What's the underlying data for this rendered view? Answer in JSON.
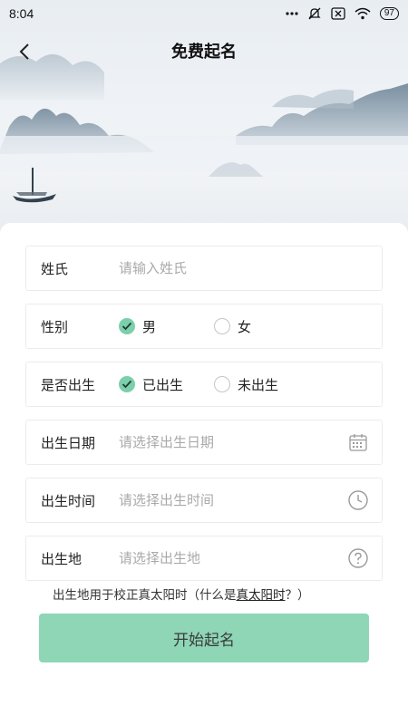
{
  "status_bar": {
    "time": "8:04",
    "battery": "97",
    "icons": [
      "dots-icon",
      "mute-bell-icon",
      "sim-x-icon",
      "wifi-icon",
      "battery-icon"
    ]
  },
  "header": {
    "title": "免费起名",
    "back_icon": "chevron-left-icon"
  },
  "form": {
    "surname": {
      "label": "姓氏",
      "placeholder": "请输入姓氏"
    },
    "gender": {
      "label": "性别",
      "options": [
        {
          "label": "男",
          "checked": true
        },
        {
          "label": "女",
          "checked": false
        }
      ]
    },
    "born": {
      "label": "是否出生",
      "options": [
        {
          "label": "已出生",
          "checked": true
        },
        {
          "label": "未出生",
          "checked": false
        }
      ]
    },
    "birth_date": {
      "label": "出生日期",
      "placeholder": "请选择出生日期",
      "icon": "calendar-icon"
    },
    "birth_time": {
      "label": "出生时间",
      "placeholder": "请选择出生时间",
      "icon": "clock-icon"
    },
    "birth_place": {
      "label": "出生地",
      "placeholder": "请选择出生地",
      "icon": "help-circle-icon"
    }
  },
  "note": {
    "prefix": "出生地用于校正真太阳时（什么是",
    "link": "真太阳时",
    "suffix": "？）"
  },
  "submit_label": "开始起名",
  "colors": {
    "accent": "#7ccfac",
    "button": "#8ed6b6",
    "placeholder": "#a9a9a9"
  }
}
